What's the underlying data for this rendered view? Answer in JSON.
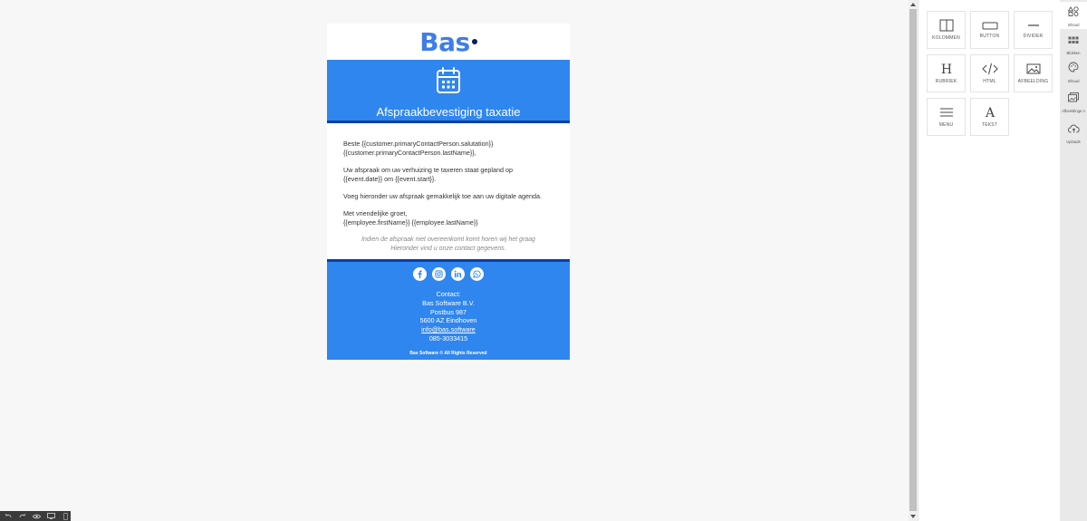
{
  "email": {
    "logo": "Bas",
    "title": "Afspraakbevestiging taxatie",
    "paragraphs": [
      "Beste  {{customer.primaryContactPerson.salutation}} {{customer.primaryContactPerson.lastName}},",
      "Uw afspraak om uw verhuizing te taxeren staat gepland op {{event.date}} om {{event.start}}.",
      "Voeg hieronder uw afspraak gemakkelijk toe aan uw digitale agenda."
    ],
    "closing_line1": "Met vriendelijke groet,",
    "closing_line2": "{{employee.firstName}} {{employee.lastName}}",
    "note_line1": "Indien de afspraak niet overeenkomt komt horen wij het graag",
    "note_line2": "Hieronder vind u onze contact gegevens.",
    "footer": {
      "social": [
        "facebook-icon",
        "instagram-icon",
        "linkedin-icon",
        "whatsapp-icon"
      ],
      "contact_label": "Contact:",
      "company": "Bas Software B.V.",
      "postbus": "Postbus 987",
      "city": "5600 AZ Eindhoven",
      "email": "info@bas.software",
      "phone": "085-3033415",
      "copyright": "Bas Software ©  All Rights Reserved"
    }
  },
  "panel": {
    "tiles": [
      {
        "name": "columns",
        "label": "KOLOMMEN"
      },
      {
        "name": "button",
        "label": "BUTTON"
      },
      {
        "name": "divider",
        "label": "DIVIDER"
      },
      {
        "name": "heading",
        "label": "RUBRIEK"
      },
      {
        "name": "html",
        "label": "HTML"
      },
      {
        "name": "image",
        "label": "AFBEELDING"
      },
      {
        "name": "menu",
        "label": "MENU"
      },
      {
        "name": "text",
        "label": "TEKST"
      }
    ]
  },
  "sidebar": {
    "items": [
      {
        "name": "content",
        "label": "Inhoud"
      },
      {
        "name": "blocks",
        "label": "Blokken"
      },
      {
        "name": "body",
        "label": "Inhoud"
      },
      {
        "name": "images",
        "label": "Afbeeldinge n"
      },
      {
        "name": "uploads",
        "label": "Uploads"
      }
    ]
  },
  "colors": {
    "brand_blue": "#2f86ee",
    "dark_blue": "#0a3fa8",
    "logo_blue": "#3f7de8"
  }
}
